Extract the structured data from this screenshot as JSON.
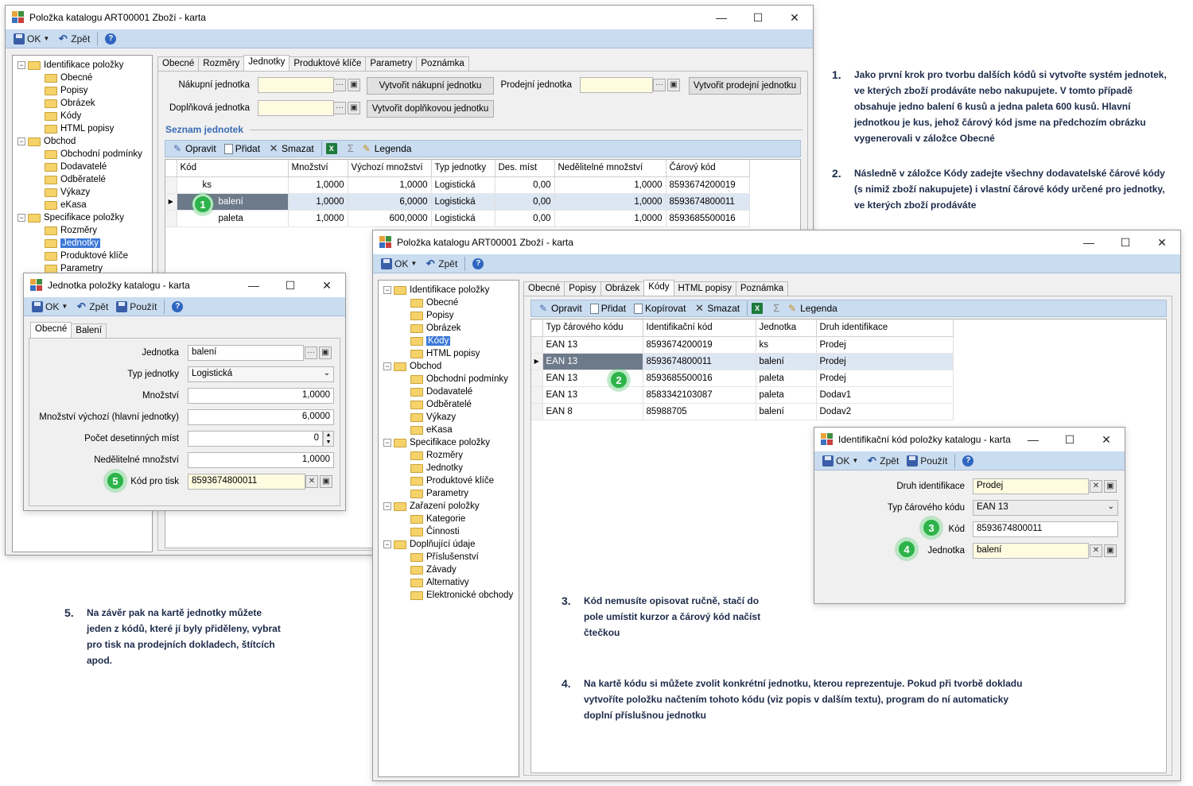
{
  "w1": {
    "title": "Položka katalogu ART00001 Zboží - karta",
    "ok": "OK",
    "back": "Zpět",
    "tree": [
      {
        "label": "Identifikace položky",
        "level": 0
      },
      {
        "label": "Obecné",
        "level": 1
      },
      {
        "label": "Popisy",
        "level": 1
      },
      {
        "label": "Obrázek",
        "level": 1
      },
      {
        "label": "Kódy",
        "level": 1
      },
      {
        "label": "HTML popisy",
        "level": 1
      },
      {
        "label": "Obchod",
        "level": 0
      },
      {
        "label": "Obchodní podmínky",
        "level": 1
      },
      {
        "label": "Dodavatelé",
        "level": 1
      },
      {
        "label": "Odběratelé",
        "level": 1
      },
      {
        "label": "Výkazy",
        "level": 1
      },
      {
        "label": "eKasa",
        "level": 1
      },
      {
        "label": "Specifikace položky",
        "level": 0
      },
      {
        "label": "Rozměry",
        "level": 1
      },
      {
        "label": "Jednotky",
        "level": 1
      },
      {
        "label": "Produktové klíče",
        "level": 1
      },
      {
        "label": "Parametry",
        "level": 1
      }
    ],
    "tabs": [
      "Obecné",
      "Rozměry",
      "Jednotky",
      "Produktové klíče",
      "Parametry",
      "Poznámka"
    ],
    "nakupni_label": "Nákupní jednotka",
    "prodejni_label": "Prodejní jednotka",
    "doplnkova_label": "Doplňková jednotka",
    "btn_nakupni": "Vytvořit nákupní jednotku",
    "btn_prodejni": "Vytvořit prodejní jednotku",
    "btn_doplnkova": "Vytvořit doplňkovou jednotku",
    "section": "Seznam jednotek",
    "grid_tools": {
      "edit": "Opravit",
      "add": "Přidat",
      "del": "Smazat",
      "legend": "Legenda"
    },
    "cols": [
      "Kód",
      "Množství",
      "Výchozí množství",
      "Typ jednotky",
      "Des. míst",
      "Nedělitelné množství",
      "Čárový kód"
    ],
    "rows": [
      [
        "ks",
        "1,0000",
        "1,0000",
        "Logistická",
        "0,00",
        "1,0000",
        "8593674200019"
      ],
      [
        "balení",
        "1,0000",
        "6,0000",
        "Logistická",
        "0,00",
        "1,0000",
        "8593674800011"
      ],
      [
        "paleta",
        "1,0000",
        "600,0000",
        "Logistická",
        "0,00",
        "1,0000",
        "8593685500016"
      ]
    ]
  },
  "w2": {
    "title": "Položka katalogu ART00001 Zboží - karta",
    "ok": "OK",
    "back": "Zpět",
    "tree": [
      {
        "label": "Identifikace položky",
        "level": 0
      },
      {
        "label": "Obecné",
        "level": 1
      },
      {
        "label": "Popisy",
        "level": 1
      },
      {
        "label": "Obrázek",
        "level": 1
      },
      {
        "label": "Kódy",
        "level": 1
      },
      {
        "label": "HTML popisy",
        "level": 1
      },
      {
        "label": "Obchod",
        "level": 0
      },
      {
        "label": "Obchodní podmínky",
        "level": 1
      },
      {
        "label": "Dodavatelé",
        "level": 1
      },
      {
        "label": "Odběratelé",
        "level": 1
      },
      {
        "label": "Výkazy",
        "level": 1
      },
      {
        "label": "eKasa",
        "level": 1
      },
      {
        "label": "Specifikace položky",
        "level": 0
      },
      {
        "label": "Rozměry",
        "level": 1
      },
      {
        "label": "Jednotky",
        "level": 1
      },
      {
        "label": "Produktové klíče",
        "level": 1
      },
      {
        "label": "Parametry",
        "level": 1
      },
      {
        "label": "Zařazení položky",
        "level": 0
      },
      {
        "label": "Kategorie",
        "level": 1
      },
      {
        "label": "Činnosti",
        "level": 1
      },
      {
        "label": "Doplňující údaje",
        "level": 0
      },
      {
        "label": "Příslušenství",
        "level": 1
      },
      {
        "label": "Závady",
        "level": 1
      },
      {
        "label": "Alternativy",
        "level": 1
      },
      {
        "label": "Elektronické obchody",
        "level": 1
      }
    ],
    "tabs": [
      "Obecné",
      "Popisy",
      "Obrázek",
      "Kódy",
      "HTML popisy",
      "Poznámka"
    ],
    "grid_tools": {
      "edit": "Opravit",
      "add": "Přidat",
      "copy": "Kopírovat",
      "del": "Smazat",
      "legend": "Legenda"
    },
    "cols": [
      "Typ čárového kódu",
      "Identifikační kód",
      "Jednotka",
      "Druh identifikace"
    ],
    "rows": [
      [
        "EAN 13",
        "8593674200019",
        "ks",
        "Prodej"
      ],
      [
        "EAN 13",
        "8593674800011",
        "balení",
        "Prodej"
      ],
      [
        "EAN 13",
        "8593685500016",
        "paleta",
        "Prodej"
      ],
      [
        "EAN 13",
        "8583342103087",
        "paleta",
        "Dodav1"
      ],
      [
        "EAN 8",
        "85988705",
        "balení",
        "Dodav2"
      ]
    ]
  },
  "w3": {
    "title": "Jednotka položky katalogu - karta",
    "ok": "OK",
    "back": "Zpět",
    "apply": "Použít",
    "tabs": [
      "Obecné",
      "Balení"
    ],
    "l_jednotka": "Jednotka",
    "v_jednotka": "balení",
    "l_typ": "Typ jednotky",
    "v_typ": "Logistická",
    "l_mnozstvi": "Množství",
    "v_mnozstvi": "1,0000",
    "l_vychozi": "Množství výchozí (hlavní jednotky)",
    "v_vychozi": "6,0000",
    "l_des": "Počet desetinných míst",
    "v_des": "0",
    "l_nedel": "Nedělitelné množství",
    "v_nedel": "1,0000",
    "l_kod": "Kód pro tisk",
    "v_kod": "8593674800011"
  },
  "w4": {
    "title": "Identifikační kód položky katalogu - karta",
    "ok": "OK",
    "back": "Zpět",
    "apply": "Použít",
    "l_druh": "Druh identifikace",
    "v_druh": "Prodej",
    "l_typ": "Typ čárového kódu",
    "v_typ": "EAN 13",
    "l_kod": "Kód",
    "v_kod": "8593674800011",
    "l_jed": "Jednotka",
    "v_jed": "balení"
  },
  "notes": {
    "n1num": "1.",
    "n1": "Jako první krok pro tvorbu dalších kódů si vytvořte systém jednotek, ve kterých zboží prodáváte nebo nakupujete. V tomto případě obsahuje jedno balení 6 kusů a jedna paleta 600 kusů. Hlavní jednotkou je kus, jehož čárový kód jsme na předchozím obrázku vygenerovali v záložce Obecné",
    "n2num": "2.",
    "n2": "Následně v záložce Kódy zadejte všechny dodavatelské čárové kódy (s nimiž zboží nakupujete) i vlastní čárové kódy určené pro jednotky, ve kterých zboží prodáváte",
    "n3num": "3.",
    "n3": "Kód nemusíte opisovat ručně, stačí do pole umístit kurzor a čárový kód načíst čtečkou",
    "n4num": "4.",
    "n4": "Na kartě kódu si můžete zvolit konkrétní jednotku, kterou reprezentuje. Pokud při tvorbě dokladu vytvoříte položku načtením tohoto kódu (viz popis v dalším textu), program do ní automaticky doplní příslušnou jednotku",
    "n5num": "5.",
    "n5": "Na závěr pak na kartě jednotky můžete jeden z kódů, které jí byly přiděleny, vybrat pro tisk na prodejních dokladech, štítcích apod."
  },
  "badges": [
    "1",
    "2",
    "3",
    "4",
    "5"
  ],
  "colors": {
    "toolbar": "#c9dcf0",
    "selection": "#3b78d8",
    "badge": "#2db34a",
    "note_text": "#1c2a4a",
    "yellow_field": "#fffbe0"
  }
}
